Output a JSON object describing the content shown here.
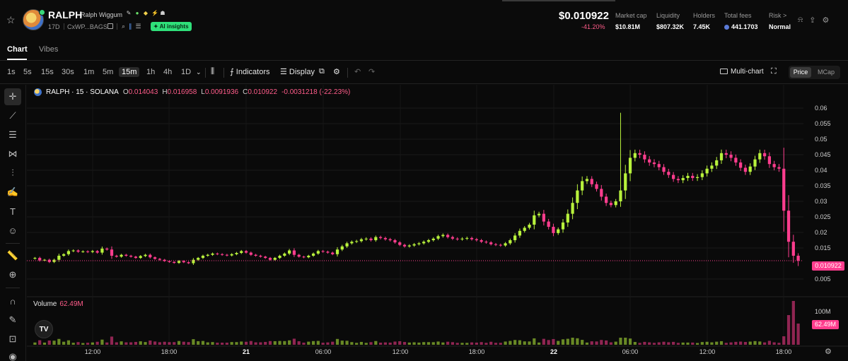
{
  "header": {
    "title": "RALPH",
    "subtitle": "Ralph Wiggum",
    "age": "17D",
    "address": "CxWP...BAGS",
    "ai_label": "AI insights",
    "price": "$0.010922",
    "change": "-41.20%",
    "stats": [
      {
        "label": "Market cap",
        "value": "$10.81M"
      },
      {
        "label": "Liquidity",
        "value": "$807.32K"
      },
      {
        "label": "Holders",
        "value": "7.45K"
      },
      {
        "label": "Total fees",
        "value": "441.1703"
      },
      {
        "label": "Risk >",
        "value": "Normal"
      }
    ]
  },
  "tabs": [
    {
      "label": "Chart"
    },
    {
      "label": "Vibes"
    }
  ],
  "toolbar": {
    "timeframes": [
      "1s",
      "5s",
      "15s",
      "30s",
      "1m",
      "5m",
      "15m",
      "1h",
      "4h",
      "1D"
    ],
    "active_timeframe": "15m",
    "indicators_label": "Indicators",
    "display_label": "Display",
    "multichart_label": "Multi-chart",
    "price_label": "Price",
    "mcap_label": "MCap"
  },
  "legend": {
    "symbol": "RALPH · 15 · SOLANA",
    "o_key": "O",
    "o": "0.014043",
    "h_key": "H",
    "h": "0.016958",
    "l_key": "L",
    "l": "0.0091936",
    "c_key": "C",
    "c": "0.010922",
    "change": "-0.0031218 (-22.23%)"
  },
  "volume": {
    "label": "Volume",
    "value": "62.49M",
    "axis_label": "100M"
  },
  "price_tag": "0.010922",
  "colors": {
    "up": "#b8f23c",
    "down": "#ff3d8e",
    "background": "#0a0a0a"
  },
  "chart_data": {
    "type": "candlestick",
    "title": "RALPH · 15 · SOLANA",
    "y_ticks": [
      0.005,
      0.015,
      0.02,
      0.025,
      0.03,
      0.035,
      0.04,
      0.045,
      0.05,
      0.055,
      0.06
    ],
    "y_tick_labels": [
      "0.005",
      "0.015",
      "0.02",
      "0.025",
      "0.03",
      "0.035",
      "0.04",
      "0.045",
      "0.05",
      "0.055",
      "0.06"
    ],
    "x_tick_labels": [
      "12:00",
      "18:00",
      "21",
      "06:00",
      "12:00",
      "18:00",
      "22",
      "06:00",
      "12:00",
      "18:00"
    ],
    "ylim": [
      0.0,
      0.0625
    ],
    "close_series": [
      0.0118,
      0.011,
      0.0112,
      0.0105,
      0.0112,
      0.0125,
      0.013,
      0.014,
      0.0142,
      0.0138,
      0.0139,
      0.0137,
      0.014,
      0.0135,
      0.0148,
      0.0145,
      0.0125,
      0.0122,
      0.0128,
      0.0125,
      0.0122,
      0.0118,
      0.0124,
      0.0128,
      0.012,
      0.0115,
      0.0112,
      0.0108,
      0.0105,
      0.0102,
      0.0108,
      0.0104,
      0.0101,
      0.0112,
      0.0118,
      0.0125,
      0.0128,
      0.0132,
      0.013,
      0.0128,
      0.0126,
      0.013,
      0.0134,
      0.014,
      0.0135,
      0.0128,
      0.0125,
      0.0122,
      0.0118,
      0.0112,
      0.0118,
      0.0125,
      0.0132,
      0.0142,
      0.0128,
      0.0122,
      0.012,
      0.0125,
      0.0132,
      0.014,
      0.0138,
      0.0135,
      0.013,
      0.0145,
      0.0155,
      0.0165,
      0.017,
      0.0172,
      0.0178,
      0.018,
      0.0175,
      0.0185,
      0.0182,
      0.0178,
      0.0175,
      0.0168,
      0.016,
      0.0155,
      0.0158,
      0.0162,
      0.0165,
      0.017,
      0.0175,
      0.018,
      0.0188,
      0.0192,
      0.0185,
      0.018,
      0.0178,
      0.018,
      0.0182,
      0.0178,
      0.0175,
      0.017,
      0.0168,
      0.0162,
      0.016,
      0.0158,
      0.0165,
      0.0175,
      0.019,
      0.0205,
      0.0215,
      0.0225,
      0.0255,
      0.026,
      0.0235,
      0.0218,
      0.0198,
      0.021,
      0.0232,
      0.026,
      0.0295,
      0.0335,
      0.0365,
      0.0372,
      0.0355,
      0.034,
      0.0315,
      0.0295,
      0.0288,
      0.03,
      0.0335,
      0.039,
      0.044,
      0.0455,
      0.045,
      0.0435,
      0.0425,
      0.042,
      0.041,
      0.0395,
      0.0385,
      0.0372,
      0.0368,
      0.0375,
      0.0382,
      0.0375,
      0.0378,
      0.039,
      0.0405,
      0.0415,
      0.0432,
      0.0455,
      0.045,
      0.044,
      0.0425,
      0.0408,
      0.0395,
      0.0412,
      0.0435,
      0.0455,
      0.0445,
      0.042,
      0.041,
      0.0405,
      0.027,
      0.017,
      0.0125,
      0.010922
    ],
    "volume_max_label": "100M"
  }
}
